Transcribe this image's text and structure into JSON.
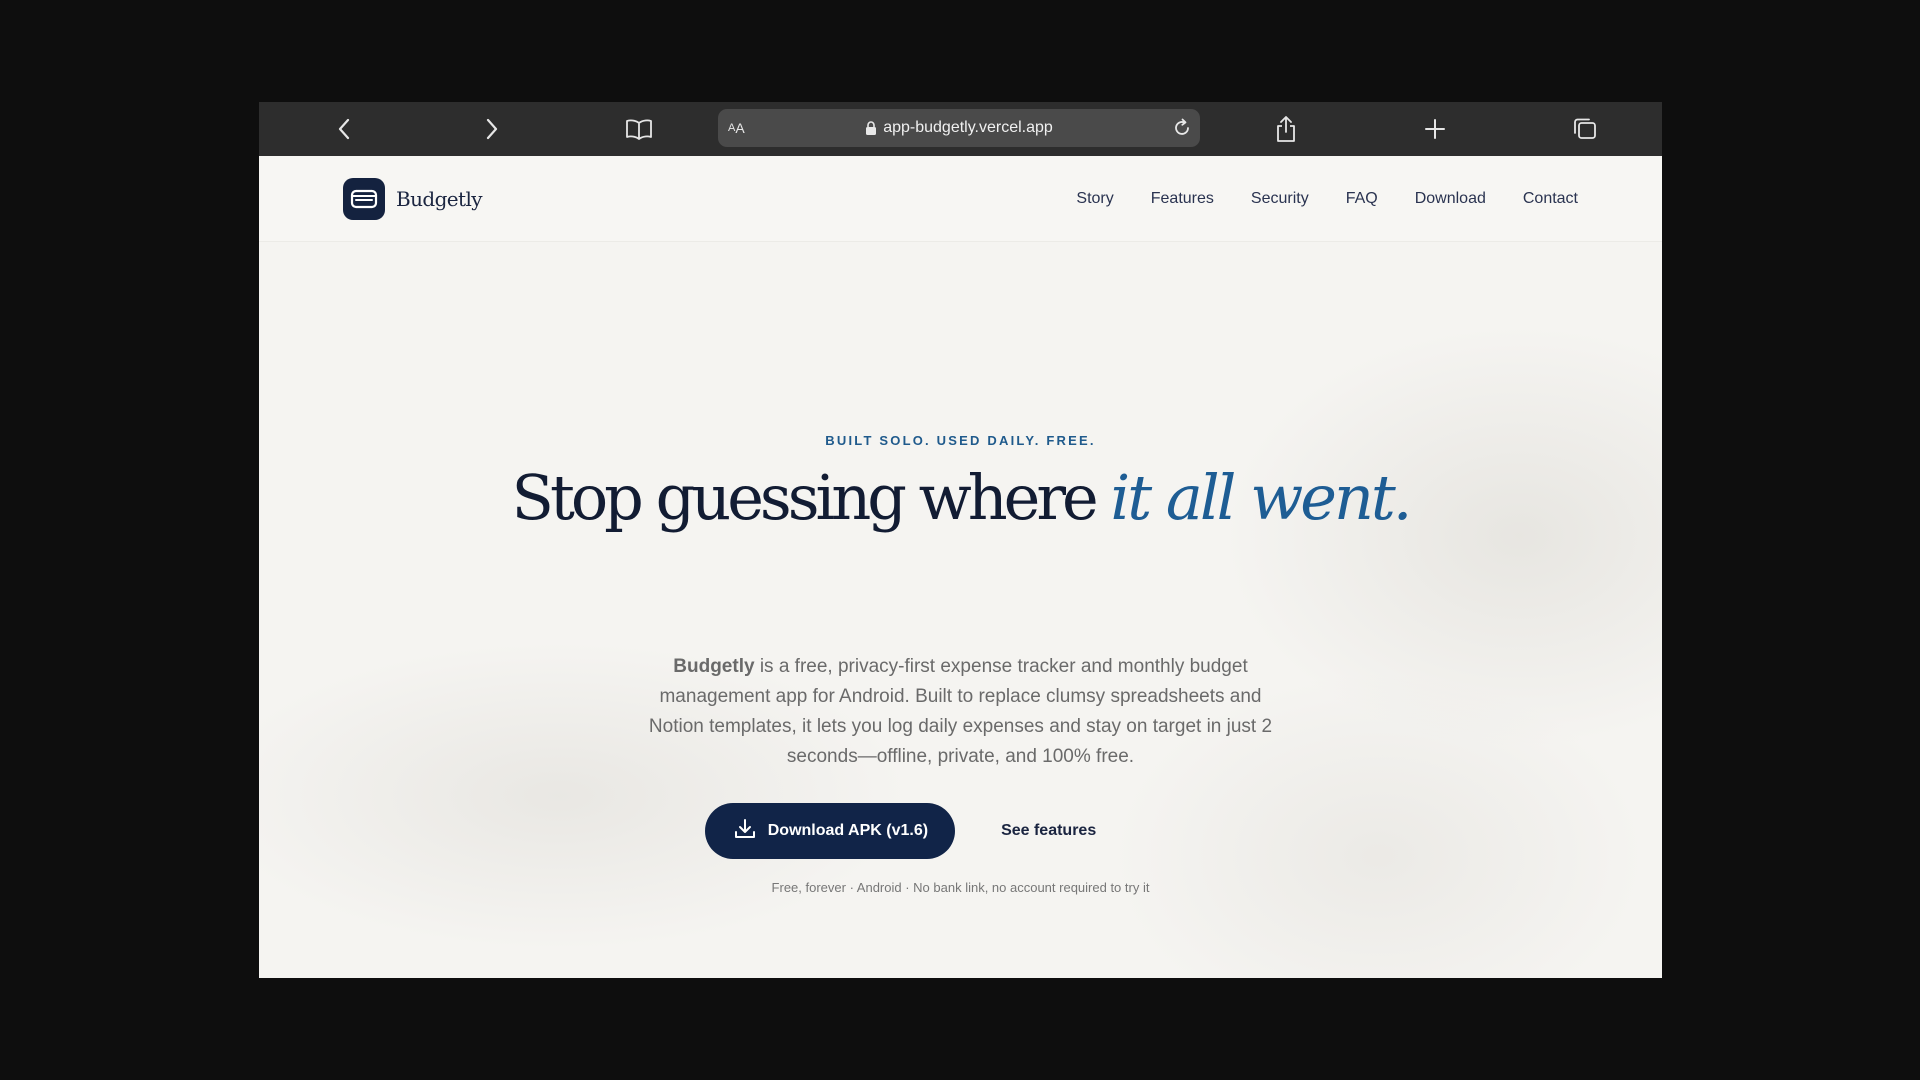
{
  "browser": {
    "url": "app-budgetly.vercel.app",
    "reader_label_small": "A",
    "reader_label_large": "A",
    "icons": {
      "back": "chevron-left-icon",
      "forward": "chevron-right-icon",
      "bookmarks": "book-icon",
      "lock": "lock-icon",
      "reload": "reload-icon",
      "share": "share-icon",
      "new_tab": "plus-icon",
      "tabs": "tabs-icon"
    }
  },
  "nav": {
    "brand": "Budgetly",
    "links": [
      "Story",
      "Features",
      "Security",
      "FAQ",
      "Download",
      "Contact"
    ]
  },
  "hero": {
    "eyebrow": "BUILT SOLO. USED DAILY. FREE.",
    "headline_main": "Stop guessing where ",
    "headline_accent": "it all went.",
    "lead_brand": "Budgetly",
    "lead_rest": " is a free, privacy-first expense tracker and monthly budget management app for Android. Built to replace clumsy spreadsheets and Notion templates, it lets you log daily expenses and stay on target in just 2 seconds—offline, private, and 100% free.",
    "primary_cta": "Download APK (v1.6)",
    "secondary_cta": "See features",
    "footnote": "Free, forever · Android · No bank link, no account required to try it"
  },
  "colors": {
    "navy": "#112448",
    "accent_blue": "#1e5d94",
    "toolbar": "#2d2d2d",
    "page_bg": "#f5f4f1"
  }
}
